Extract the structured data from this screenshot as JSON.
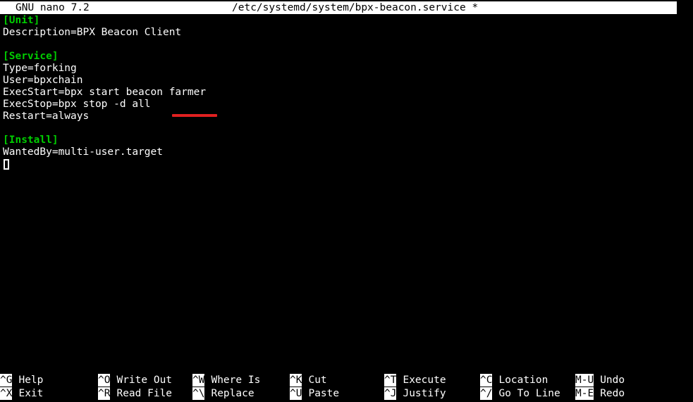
{
  "titlebar": {
    "version": "GNU nano 7.2",
    "path": "/etc/systemd/system/bpx-beacon.service *"
  },
  "editor": {
    "lines": [
      {
        "text": "[Unit]",
        "kind": "section"
      },
      {
        "text": "Description=BPX Beacon Client",
        "kind": "text"
      },
      {
        "text": "",
        "kind": "blank"
      },
      {
        "text": "[Service]",
        "kind": "section"
      },
      {
        "text": "Type=forking",
        "kind": "text"
      },
      {
        "text": "User=bpxchain",
        "kind": "text"
      },
      {
        "text": "ExecStart=bpx start beacon farmer",
        "kind": "text"
      },
      {
        "text": "ExecStop=bpx stop -d all",
        "kind": "text"
      },
      {
        "text": "Restart=always",
        "kind": "text"
      },
      {
        "text": "",
        "kind": "blank"
      },
      {
        "text": "[Install]",
        "kind": "section"
      },
      {
        "text": "WantedBy=multi-user.target",
        "kind": "text"
      }
    ],
    "annotation": {
      "underlined_word": "farmer",
      "color": "#e02020"
    },
    "cursor": {
      "line": 13,
      "column": 1
    }
  },
  "footer": {
    "shortcuts": [
      {
        "key": "^G",
        "label": "Help",
        "col": 0,
        "row": 0
      },
      {
        "key": "^X",
        "label": "Exit",
        "col": 0,
        "row": 1
      },
      {
        "key": "^O",
        "label": "Write Out",
        "col": 139,
        "row": 0
      },
      {
        "key": "^R",
        "label": "Read File",
        "col": 139,
        "row": 1
      },
      {
        "key": "^W",
        "label": "Where Is",
        "col": 273,
        "row": 0
      },
      {
        "key": "^\\",
        "label": "Replace",
        "col": 273,
        "row": 1
      },
      {
        "key": "^K",
        "label": "Cut",
        "col": 411,
        "row": 0
      },
      {
        "key": "^U",
        "label": "Paste",
        "col": 411,
        "row": 1
      },
      {
        "key": "^T",
        "label": "Execute",
        "col": 545,
        "row": 0
      },
      {
        "key": "^J",
        "label": "Justify",
        "col": 545,
        "row": 1
      },
      {
        "key": "^C",
        "label": "Location",
        "col": 681,
        "row": 0
      },
      {
        "key": "^/",
        "label": "Go To Line",
        "col": 681,
        "row": 1
      },
      {
        "key": "M-U",
        "label": "Undo",
        "col": 816,
        "row": 0
      },
      {
        "key": "M-E",
        "label": "Redo",
        "col": 816,
        "row": 1
      }
    ]
  },
  "colors": {
    "background": "#000000",
    "foreground": "#ffffff",
    "section_header": "#00cc00",
    "titlebar_background": "#ffffff",
    "titlebar_foreground": "#000000",
    "annotation": "#e02020"
  }
}
